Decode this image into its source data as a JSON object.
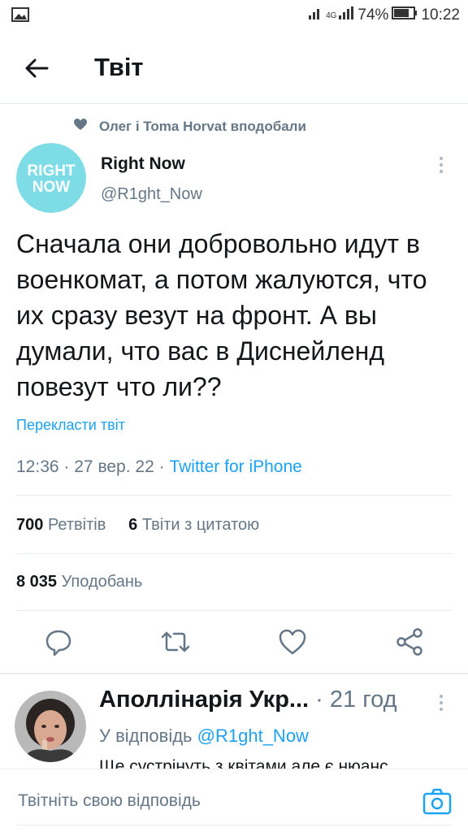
{
  "status_bar": {
    "network": "4G",
    "battery": "74%",
    "time": "10:22"
  },
  "header": {
    "title": "Твіт"
  },
  "social_context": {
    "text": "Олег і Toma Horvat вподобали"
  },
  "tweet": {
    "author_name": "Right Now",
    "author_handle": "@R1ght_Now",
    "avatar_text_line1": "RIGHT",
    "avatar_text_line2": "NOW",
    "text": "Сначала они добровольно идут в военкомат, а потом жалуются, что их сразу везут на фронт. А вы думали, что вас в Диснейленд повезут что ли??",
    "translate_label": "Перекласти твіт",
    "time": "12:36",
    "date": "27 вер. 22",
    "separator": "·",
    "source": "Twitter for iPhone",
    "retweets_count": "700",
    "retweets_label": "Ретвітів",
    "quotes_count": "6",
    "quotes_label": "Твіти з цитатою",
    "likes_count": "8 035",
    "likes_label": "Уподобань"
  },
  "actions": [
    "reply-icon",
    "retweet-icon",
    "like-icon",
    "share-icon"
  ],
  "reply": {
    "author_name": "Аполлінарія Укр...",
    "separator": "·",
    "time": "21 год",
    "reply_to_label": "У відповідь",
    "reply_to_handle": "@R1ght_Now",
    "text": "Ще сустрінуть з квітами але є нюанс"
  },
  "composer": {
    "placeholder": "Твітніть свою відповідь"
  },
  "colors": {
    "accent": "#1da1f2",
    "secondary_text": "#657786",
    "avatar_bg": "#7ddce6"
  }
}
